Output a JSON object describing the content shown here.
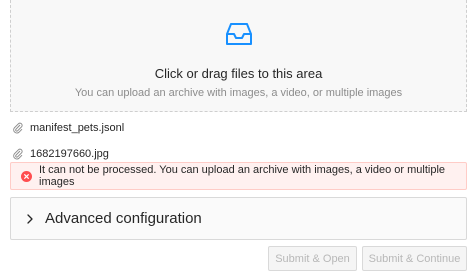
{
  "dropzone": {
    "icon": "inbox-icon",
    "title": "Click or drag files to this area",
    "hint": "You can upload an archive with images, a video, or multiple images"
  },
  "files": [
    {
      "name": "manifest_pets.jsonl",
      "icon": "paperclip-icon"
    },
    {
      "name": "1682197660.jpg",
      "icon": "paperclip-icon"
    }
  ],
  "error": {
    "icon": "close-circle-icon",
    "message": "It can not be processed. You can upload an archive with images, a video or multiple images",
    "color": "#ff4d4f"
  },
  "advanced": {
    "icon": "chevron-right-icon",
    "label": "Advanced configuration"
  },
  "actions": {
    "submit_open": "Submit & Open",
    "submit_continue": "Submit & Continue"
  },
  "colors": {
    "accent": "#1890ff",
    "error_bg": "#fff1f0",
    "error_border": "#ffccc7"
  }
}
